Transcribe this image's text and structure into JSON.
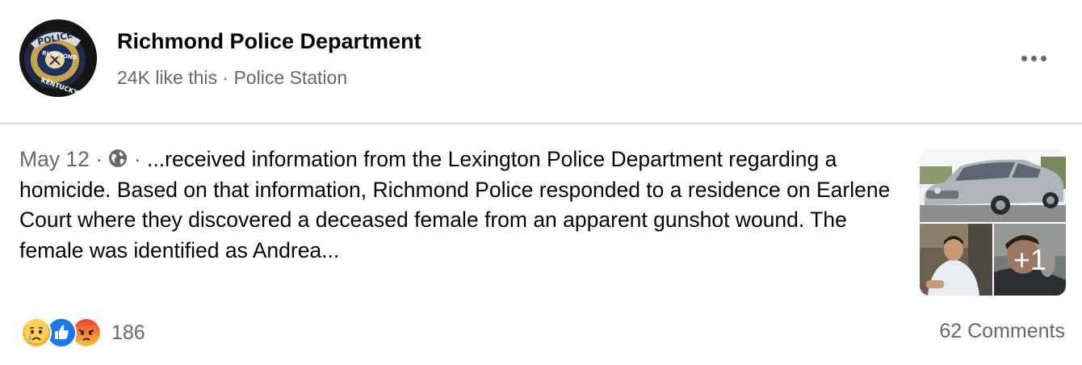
{
  "header": {
    "page_name": "Richmond Police Department",
    "likes": "24K like this",
    "separator": " · ",
    "category": "Police Station",
    "more_icon": "more-horizontal-icon",
    "avatar_badge_text": [
      "POLICE",
      "RICHMOND",
      "KENTUCKY"
    ]
  },
  "post": {
    "date": "May 12",
    "meta_sep": " · ",
    "privacy_icon": "globe-icon",
    "body": "...received information from the Lexington Police Department regarding a homicide. Based on that information, Richmond Police responded to a residence on Earlene Court where they discovered a deceased female from an apparent gunshot wound. The female was identified as Andrea...",
    "media_more_count": "+1"
  },
  "footer": {
    "reaction_icons": [
      "sad-reaction-icon",
      "like-reaction-icon",
      "angry-reaction-icon"
    ],
    "reaction_count": "186",
    "comments": "62 Comments"
  },
  "colors": {
    "text_primary": "#050505",
    "text_secondary": "#65676b",
    "like_blue": "#1877f2",
    "divider": "#d9dadc"
  }
}
